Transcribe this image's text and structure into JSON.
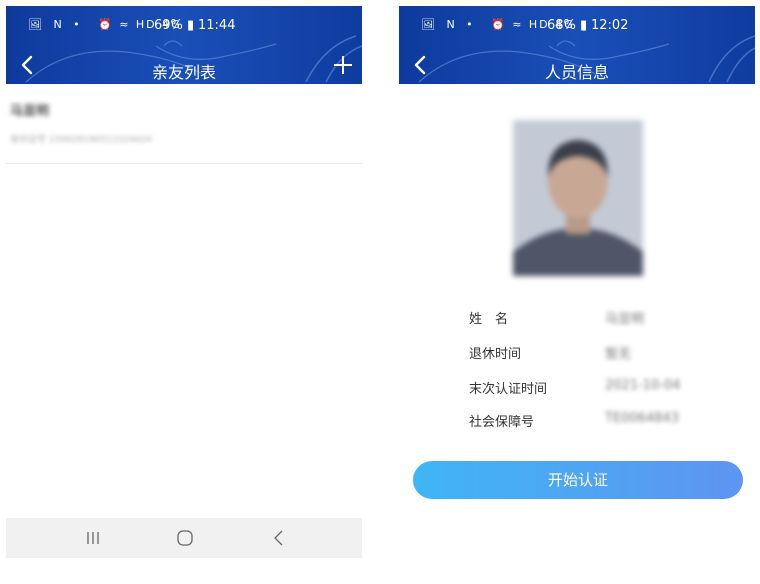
{
  "left_screen": {
    "status_bar": {
      "icons_left": "🖼 N •",
      "icons_mid": "⏰ ≈ HD 4G",
      "battery": "69% ▮",
      "time": "11:44"
    },
    "header": {
      "title": "亲友列表",
      "back_icon": "chevron-left-icon",
      "add_icon": "plus-icon"
    },
    "list": [
      {
        "name": "马显明",
        "sub": "身份证号  150029190512224424"
      }
    ],
    "nav": {
      "recents_icon": "recents-icon",
      "home_icon": "home-icon",
      "back_icon": "back-icon"
    }
  },
  "right_screen": {
    "status_bar": {
      "icons_left": "🖼 N •",
      "icons_mid": "⏰ ≈ HD 4G",
      "battery": "68% ▮",
      "time": "12:02"
    },
    "header": {
      "title": "人员信息",
      "back_icon": "chevron-left-icon"
    },
    "info": [
      {
        "label": "姓　名",
        "value": "马显明"
      },
      {
        "label": "退休时间",
        "value": "暂无"
      },
      {
        "label": "末次认证时间",
        "value": "2021-10-04"
      },
      {
        "label": "社会保障号",
        "value": "TE0064843"
      }
    ],
    "start_button": "开始认证"
  },
  "colors": {
    "header_blue": "#1a4fb8",
    "button_start": "#3fb6f4",
    "button_end": "#5e94f2"
  }
}
